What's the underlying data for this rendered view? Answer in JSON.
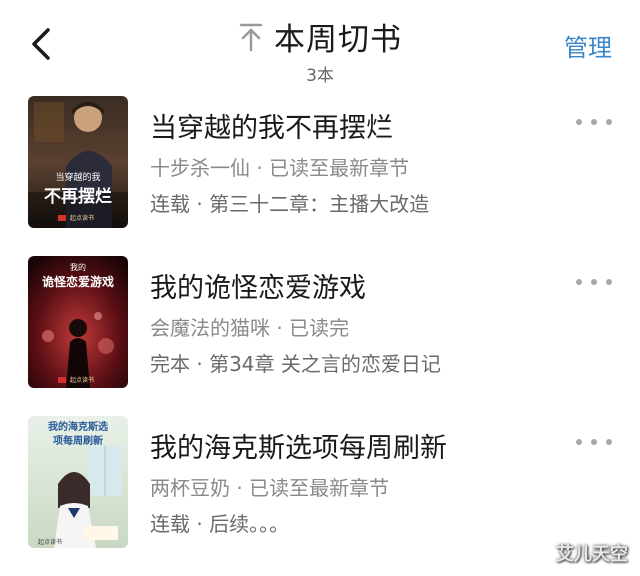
{
  "header": {
    "title": "本周切书",
    "subtitle": "3本",
    "manage_label": "管理"
  },
  "books": [
    {
      "title": "当穿越的我不再摆烂",
      "meta": "十步杀一仙 · 已读至最新章节",
      "status": "连载 · 第三十二章：主播大改造",
      "cover_title_small": "当穿越的我",
      "cover_title_big": "不再摆烂",
      "cover_brand": "起点读书"
    },
    {
      "title": "我的诡怪恋爱游戏",
      "meta": "会魔法的猫咪 · 已读完",
      "status": "完本 · 第34章 关之言的恋爱日记",
      "cover_title_small": "我的",
      "cover_title_big": "诡怪恋爱游戏",
      "cover_brand": "起点读书"
    },
    {
      "title": "我的海克斯选项每周刷新",
      "meta": "两杯豆奶 · 已读至最新章节",
      "status": "连载 · 后续。。。",
      "cover_title_small": "我的海克斯选",
      "cover_title_big": "项每周刷新",
      "cover_brand": "起点读书"
    }
  ],
  "watermark": "艾儿天空"
}
